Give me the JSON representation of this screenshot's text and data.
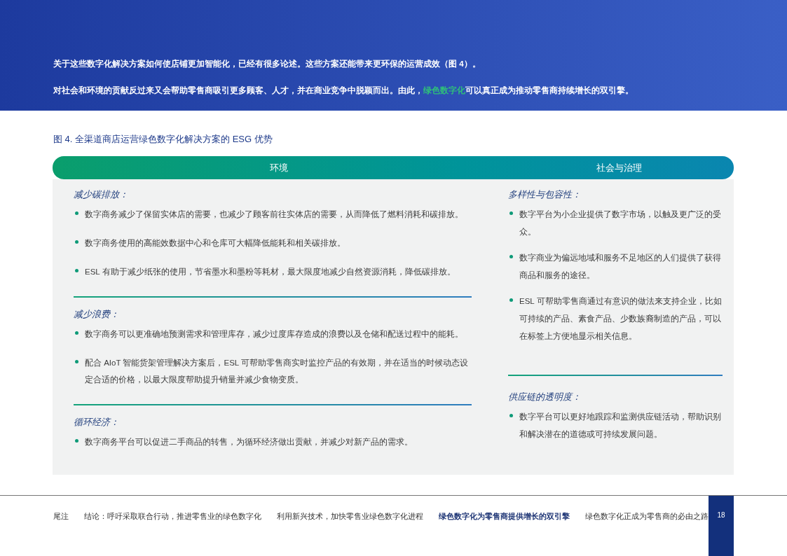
{
  "intro": [
    [
      {
        "text": "关于这些数字化解决方案如何使店铺更加智能化，已经有很多论述。这些方案还能带来更环保的运营成效（图 4）。",
        "highlight": false
      }
    ],
    [
      {
        "text": "对社会和环境的贡献反过来又会帮助零售商吸引更多顾客、人才，并在商业竞争中脱颖而出。由此，",
        "highlight": false
      },
      {
        "text": "绿色数字化",
        "highlight": true
      },
      {
        "text": "可以真正成为推动零售商持续增长的双引擎。",
        "highlight": false
      }
    ]
  ],
  "figure_title": "图 4. 全渠道商店运营绿色数字化解决方案的 ESG 优势",
  "columns": [
    {
      "heading": "环境",
      "sections": [
        {
          "title": "减少碳排放：",
          "bullets": [
            "数字商务减少了保留实体店的需要，也减少了顾客前往实体店的需要，从而降低了燃料消耗和碳排放。",
            "数字商务使用的高能效数据中心和仓库可大幅降低能耗和相关碳排放。",
            "ESL 有助于减少纸张的使用，节省墨水和墨粉等耗材，最大限度地减少自然资源消耗，降低碳排放。"
          ]
        },
        {
          "title": "减少浪费：",
          "bullets": [
            "数字商务可以更准确地预测需求和管理库存，减少过度库存造成的浪费以及仓储和配送过程中的能耗。",
            "配合 AIoT 智能货架管理解决方案后，ESL 可帮助零售商实时监控产品的有效期，并在适当的时候动态设定合适的价格，以最大限度帮助提升销量并减少食物变质。"
          ]
        },
        {
          "title": "循环经济：",
          "bullets": [
            "数字商务平台可以促进二手商品的转售，为循环经济做出贡献，并减少对新产品的需求。"
          ]
        }
      ]
    },
    {
      "heading": "社会与治理",
      "sections": [
        {
          "title": "多样性与包容性：",
          "bullets": [
            "数字平台为小企业提供了数字市场，以触及更广泛的受众。",
            "数字商业为偏远地域和服务不足地区的人们提供了获得商品和服务的途径。",
            "ESL 可帮助零售商通过有意识的做法来支持企业，比如可持续的产品、素食产品、少数族裔制造的产品，可以在标签上方便地显示相关信息。"
          ]
        },
        {
          "title": "供应链的透明度：",
          "bullets": [
            "数字平台可以更好地跟踪和监测供应链活动，帮助识别和解决潜在的道德或可持续发展问题。"
          ]
        }
      ]
    }
  ],
  "footer_nav": [
    {
      "label": "尾注",
      "selected": false
    },
    {
      "label": "结论：呼吁采取联合行动，推进零售业的绿色数字化",
      "selected": false
    },
    {
      "label": "利用新兴技术，加快零售业绿色数字化进程",
      "selected": false
    },
    {
      "label": "绿色数字化为零售商提供增长的双引擎",
      "selected": true
    },
    {
      "label": "绿色数字化正成为零售商的必由之路",
      "selected": false
    }
  ],
  "page_number": "18"
}
